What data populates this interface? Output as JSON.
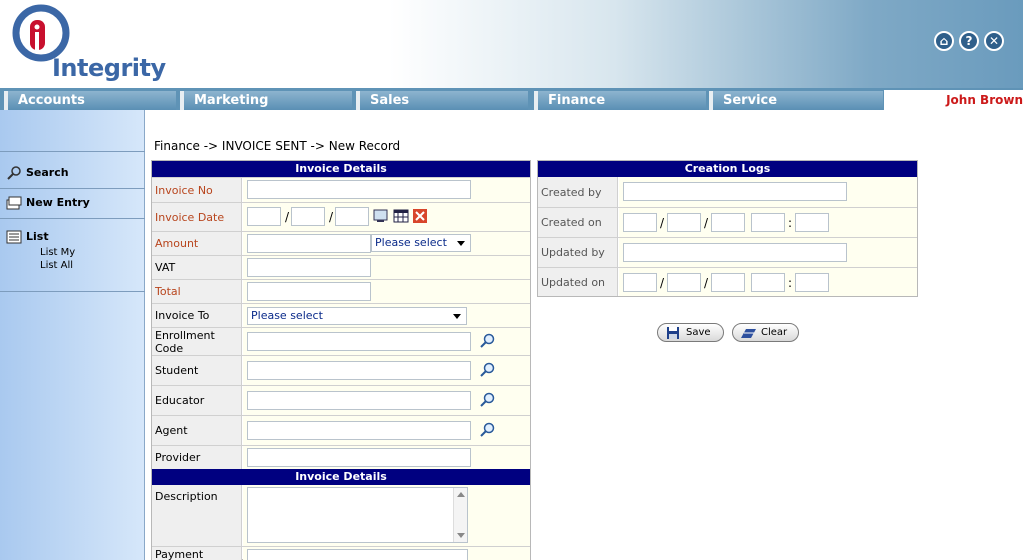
{
  "app": {
    "logo_text": "Integrity"
  },
  "header_icons": [
    "home-icon",
    "help-icon",
    "close-icon"
  ],
  "tabs": [
    "Accounts",
    "Marketing",
    "Sales",
    "Finance",
    "Service"
  ],
  "user": {
    "name": "John Brown"
  },
  "sidebar": {
    "search": "Search",
    "new_entry": "New Entry",
    "list": "List",
    "list_my": "List My",
    "list_all": "List All"
  },
  "breadcrumb": "Finance -> INVOICE SENT -> New Record",
  "invoice_details": {
    "title": "Invoice Details",
    "invoice_no": "Invoice No",
    "invoice_date": "Invoice Date",
    "amount": "Amount",
    "vat": "VAT",
    "total": "Total",
    "invoice_to": "Invoice To",
    "enrollment_code": "Enrollment Code",
    "student": "Student",
    "educator": "Educator",
    "agent": "Agent",
    "provider": "Provider",
    "amount_currency_select": "Please select",
    "invoice_to_select": "Please select"
  },
  "invoice_details2": {
    "title": "Invoice Details",
    "description": "Description",
    "payment_status": "Payment Status"
  },
  "creation_logs": {
    "title": "Creation Logs",
    "created_by": "Created by",
    "created_on": "Created on",
    "updated_by": "Updated by",
    "updated_on": "Updated on"
  },
  "buttons": {
    "save": "Save",
    "clear": "Clear"
  },
  "colors": {
    "panel_header": "#000080",
    "required_label": "#b8451d",
    "user_name": "#cc1a1a"
  }
}
